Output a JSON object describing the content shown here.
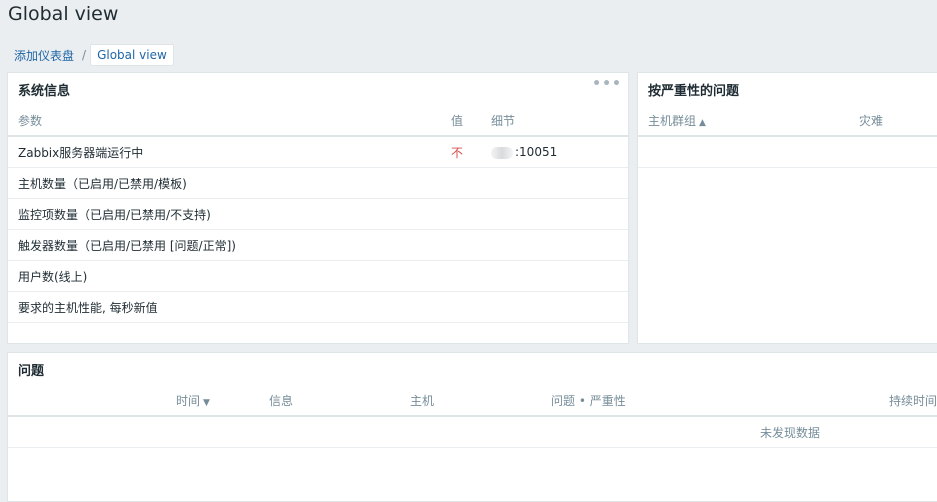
{
  "page": {
    "title": "Global view"
  },
  "breadcrumb": {
    "parent": "添加仪表盘",
    "separator": "/",
    "current": "Global view"
  },
  "system_info": {
    "title": "系统信息",
    "menu_glyph": "•••",
    "columns": {
      "param": "参数",
      "value": "值",
      "detail": "细节"
    },
    "rows": [
      {
        "param": "Zabbix服务器端运行中",
        "value": "不",
        "detail": ":10051"
      },
      {
        "param": "主机数量（已启用/已禁用/模板)",
        "value": "",
        "detail": ""
      },
      {
        "param": "监控项数量（已启用/已禁用/不支持)",
        "value": "",
        "detail": ""
      },
      {
        "param": "触发器数量（已启用/已禁用 [问题/正常])",
        "value": "",
        "detail": ""
      },
      {
        "param": "用户数(线上)",
        "value": "",
        "detail": ""
      },
      {
        "param": "要求的主机性能, 每秒新值",
        "value": "",
        "detail": ""
      }
    ]
  },
  "problems_by_severity": {
    "title": "按严重性的问题",
    "columns": {
      "host_group": "主机群组",
      "host_group_sort": "▲",
      "disaster": "灾难"
    }
  },
  "problems": {
    "title": "问题",
    "columns": {
      "time": "时间",
      "time_sort": "▼",
      "info": "信息",
      "host": "主机",
      "problem_severity": "问题 • 严重性",
      "duration": "持续时间"
    },
    "empty_message": "未发现数据"
  },
  "colors": {
    "background": "#ebeef0",
    "link": "#1f65a6",
    "alert_red": "#d64e4e",
    "header_text": "#768d99"
  }
}
